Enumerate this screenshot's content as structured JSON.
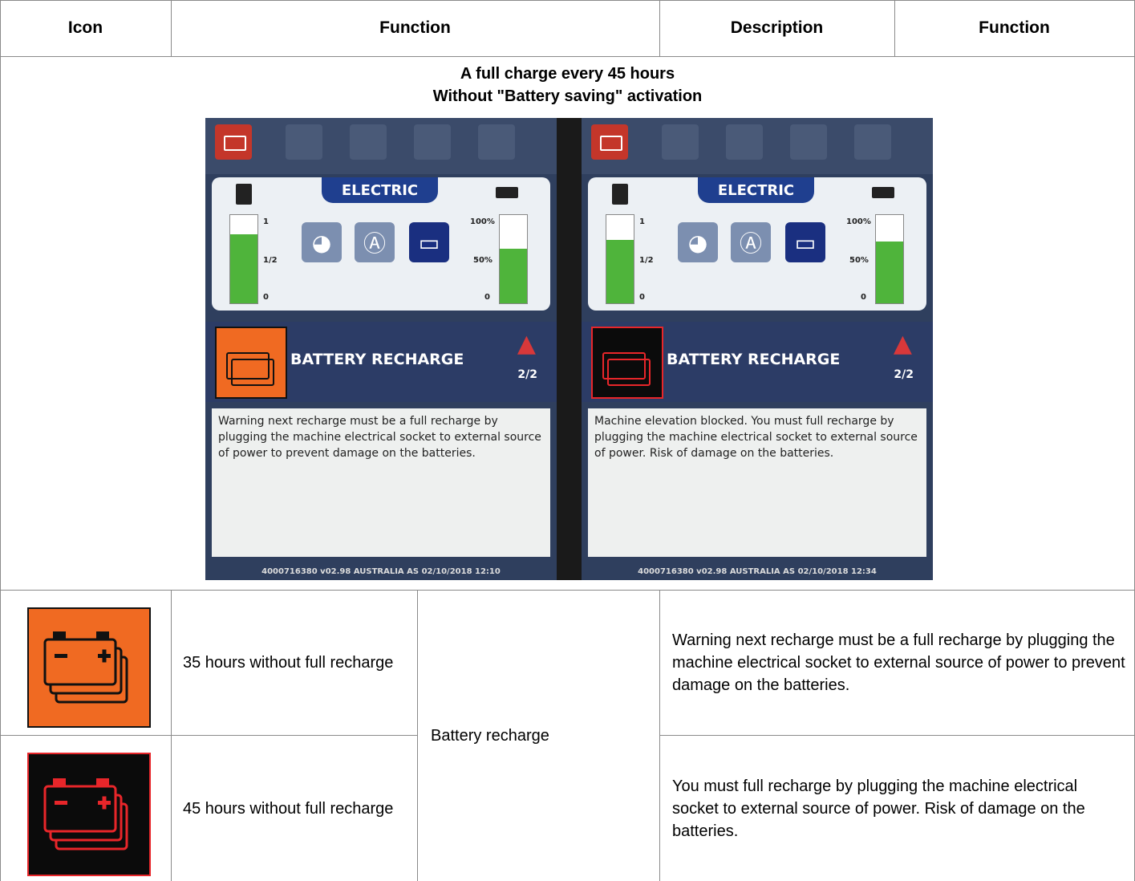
{
  "table": {
    "headers": [
      "Icon",
      "Function",
      "Description",
      "Function"
    ]
  },
  "heading": {
    "line1": "A full charge every  45 hours",
    "line2": "Without \"Battery saving\" activation"
  },
  "photo": {
    "left_screen": {
      "section_title": "ELECTRIC",
      "fuel_labels": [
        "1",
        "1/2",
        "0"
      ],
      "battery_labels": [
        "100%",
        "50%",
        "0"
      ],
      "alert_title": "BATTERY RECHARGE",
      "pager": "2/2",
      "message": "Warning next recharge must be a full recharge by plugging the machine electrical socket to external source of power to prevent damage on the batteries.",
      "footer": "4000716380  v02.98  AUSTRALIA AS  02/10/2018 12:10"
    },
    "right_screen": {
      "section_title": "ELECTRIC",
      "fuel_labels": [
        "1",
        "1/2",
        "0"
      ],
      "battery_labels": [
        "100%",
        "50%",
        "0"
      ],
      "alert_title": "BATTERY RECHARGE",
      "pager": "2/2",
      "message": "Machine elevation blocked. You must full recharge by plugging the machine electrical socket to external source of power. Risk of damage on the batteries.",
      "footer": "4000716380  v02.98  AUSTRALIA AS  02/10/2018 12:34"
    }
  },
  "rows": [
    {
      "icon": "battery-recharge-orange-icon",
      "function": " 35 hours without full recharge",
      "description": "Warning next recharge must be a full recharge by plugging the machine electrical socket to external source of power to prevent damage on the batteries."
    },
    {
      "icon": "battery-recharge-red-icon",
      "function": " 45 hours without full recharge",
      "description": "You must full recharge by plugging the machine electrical socket to external source of power. Risk of damage on the batteries."
    }
  ],
  "shared_description": "Battery recharge",
  "colors": {
    "orange": "#f06a22",
    "black": "#0b0b0b",
    "red": "#e8262a",
    "gauge_green": "#4fb43b",
    "electric_blue": "#1f3f8f"
  }
}
